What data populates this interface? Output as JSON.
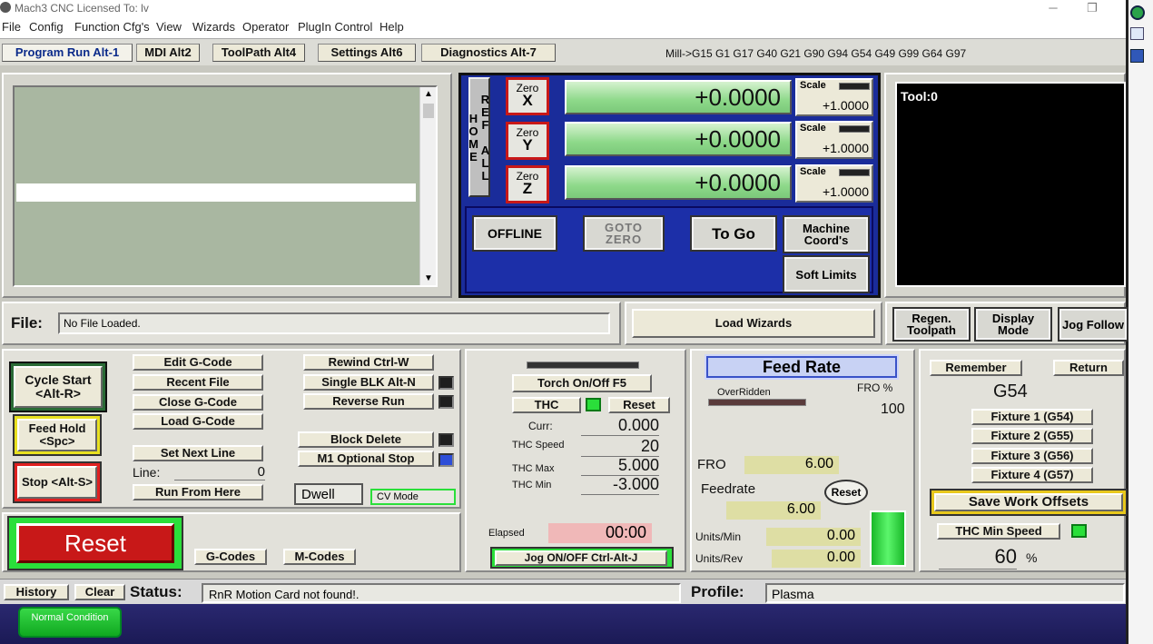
{
  "window": {
    "title": "Mach3 CNC  Licensed To: lv"
  },
  "menu": [
    "File",
    "Config",
    "Function Cfg's",
    "View",
    "Wizards",
    "Operator",
    "PlugIn Control",
    "Help"
  ],
  "tabs": [
    "Program Run Alt-1",
    "MDI Alt2",
    "ToolPath Alt4",
    "Settings Alt6",
    "Diagnostics Alt-7"
  ],
  "modal_line": "Mill->G15  G1 G17 G40 G21 G90 G94 G54 G49 G99 G64 G97",
  "dro": {
    "ref_all_home": "REF ALL HOME",
    "zero_label": "Zero",
    "axes": [
      {
        "axis": "X",
        "value": "+0.0000",
        "scale_label": "Scale",
        "scale": "+1.0000"
      },
      {
        "axis": "Y",
        "value": "+0.0000",
        "scale_label": "Scale",
        "scale": "+1.0000"
      },
      {
        "axis": "Z",
        "value": "+0.0000",
        "scale_label": "Scale",
        "scale": "+1.0000"
      }
    ],
    "offline": "OFFLINE",
    "goto_zero": "GOTO ZERO",
    "to_go": "To Go",
    "machine_coords": "Machine Coord's",
    "soft_limits": "Soft Limits"
  },
  "toolpath": {
    "tool": "Tool:0"
  },
  "file": {
    "label": "File:",
    "value": "No File Loaded."
  },
  "load_wizards": "Load Wizards",
  "toolpath_buttons": {
    "regen": "Regen. Toolpath",
    "display_mode": "Display Mode",
    "jog_follow": "Jog Follow"
  },
  "program": {
    "cycle_start": "Cycle Start <Alt-R>",
    "feed_hold": "Feed Hold <Spc>",
    "stop": "Stop <Alt-S>",
    "edit_gcode": "Edit G-Code",
    "recent_file": "Recent File",
    "close_gcode": "Close G-Code",
    "load_gcode": "Load G-Code",
    "set_next_line": "Set Next Line",
    "line_label": "Line:",
    "line_value": "0",
    "run_from_here": "Run From Here",
    "rewind": "Rewind Ctrl-W",
    "single_blk": "Single BLK Alt-N",
    "reverse_run": "Reverse Run",
    "block_delete": "Block Delete",
    "m1_optional_stop": "M1 Optional Stop",
    "dwell": "Dwell",
    "cv_mode": "CV Mode",
    "reset": "Reset",
    "gcodes": "G-Codes",
    "mcodes": "M-Codes"
  },
  "thc": {
    "torch": "Torch On/Off F5",
    "thc": "THC",
    "reset": "Reset",
    "curr_label": "Curr:",
    "curr": "0.000",
    "speed_label": "THC Speed",
    "speed": "20",
    "max_label": "THC Max",
    "max": "5.000",
    "min_label": "THC Min",
    "min": "-3.000",
    "elapsed_label": "Elapsed",
    "elapsed": "00:00",
    "jog": "Jog ON/OFF Ctrl-Alt-J"
  },
  "feed": {
    "title": "Feed Rate",
    "overridden": "OverRidden",
    "fro_pct_label": "FRO %",
    "fro_pct": "100",
    "fro_label": "FRO",
    "fro": "6.00",
    "feedrate_label": "Feedrate",
    "feedrate": "6.00",
    "reset": "Reset",
    "units_min_label": "Units/Min",
    "units_min": "0.00",
    "units_rev_label": "Units/Rev",
    "units_rev": "0.00"
  },
  "offsets": {
    "remember": "Remember",
    "return": "Return",
    "current": "G54",
    "fixtures": [
      "Fixture 1 (G54)",
      "Fixture 2 (G55)",
      "Fixture 3 (G56)",
      "Fixture 4 (G57)"
    ],
    "save": "Save Work Offsets",
    "thc_min_speed": "THC Min Speed",
    "thc_min_speed_value": "60",
    "pct": "%"
  },
  "status": {
    "history": "History",
    "clear": "Clear",
    "label": "Status:",
    "value": "RnR Motion Card not found!.",
    "profile_label": "Profile:",
    "profile": "Plasma",
    "normal_condition": "Normal Condition"
  }
}
